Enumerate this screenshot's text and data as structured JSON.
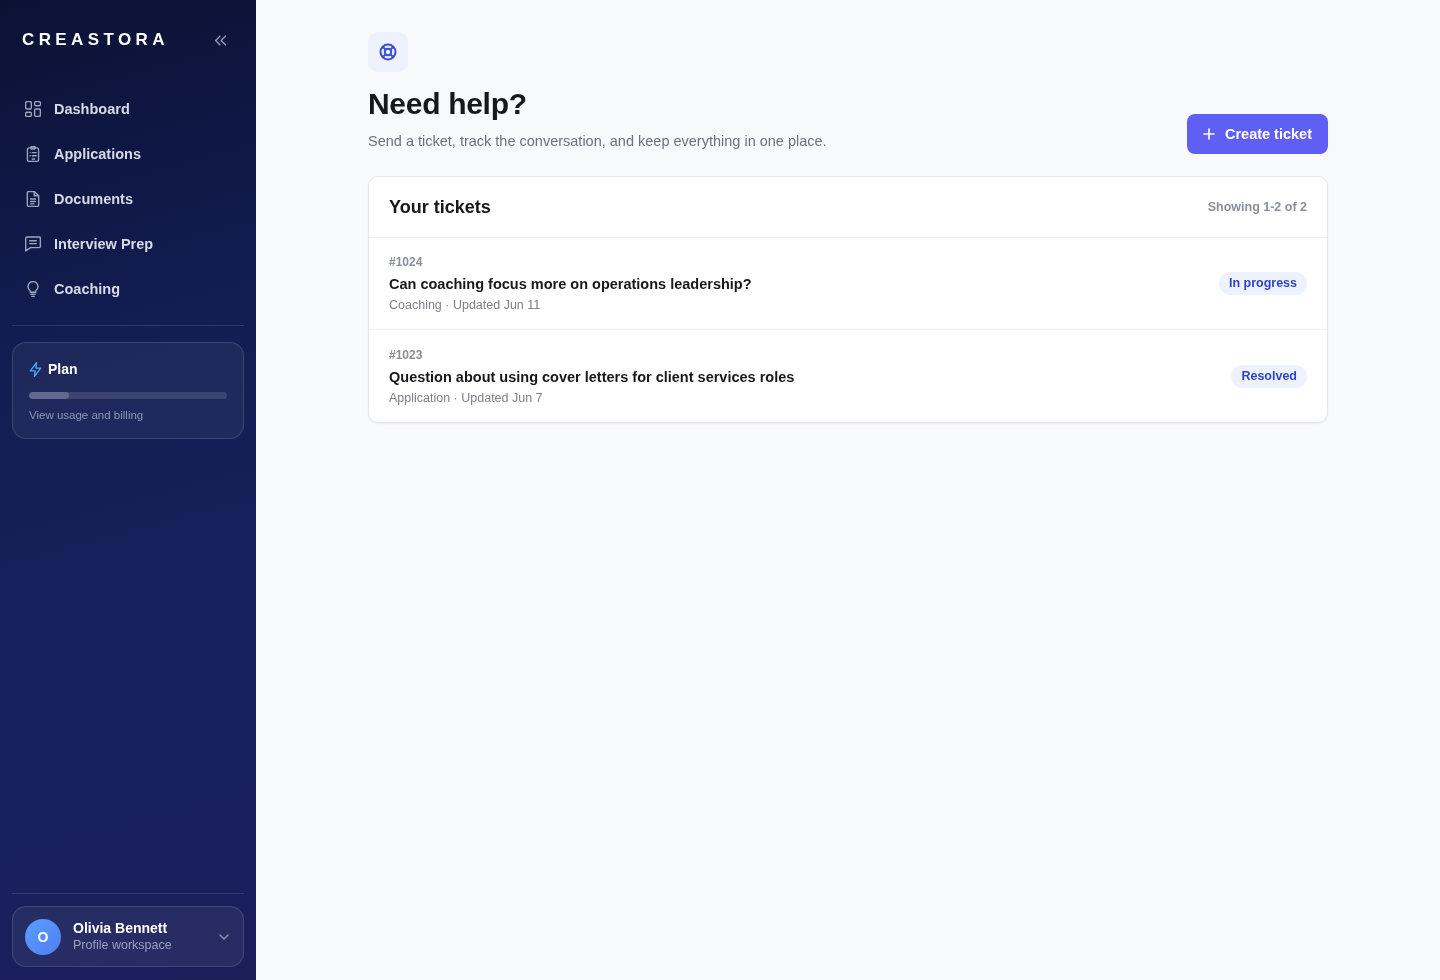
{
  "sidebar": {
    "logo": "CREASTORA",
    "nav_items": [
      {
        "label": "Dashboard",
        "selected": false
      },
      {
        "label": "Applications",
        "selected": false
      },
      {
        "label": "Documents",
        "selected": false
      },
      {
        "label": "Interview Prep",
        "selected": false
      },
      {
        "label": "Coaching",
        "selected": false
      }
    ],
    "plan": {
      "title": "Plan",
      "level": 0.2,
      "link": "View usage and billing"
    },
    "profile": {
      "initial": "O",
      "name": "Olivia Bennett",
      "subtitle": "Profile workspace"
    }
  },
  "header": {
    "title": "Need help?",
    "subtitle": "Send a ticket, track the conversation, and keep everything in one place.",
    "button": "Create ticket"
  },
  "tickets": {
    "title": "Your tickets",
    "count": "Showing 1-2 of 2",
    "rows": [
      {
        "id": "#1024",
        "title": "Can coaching focus more on operations leadership?",
        "meta": "Coaching · Updated Jun 11",
        "status": "In progress"
      },
      {
        "id": "#1023",
        "title": "Question about using cover letters for client services roles",
        "meta": "Application · Updated Jun 7",
        "status": "Resolved"
      }
    ]
  }
}
